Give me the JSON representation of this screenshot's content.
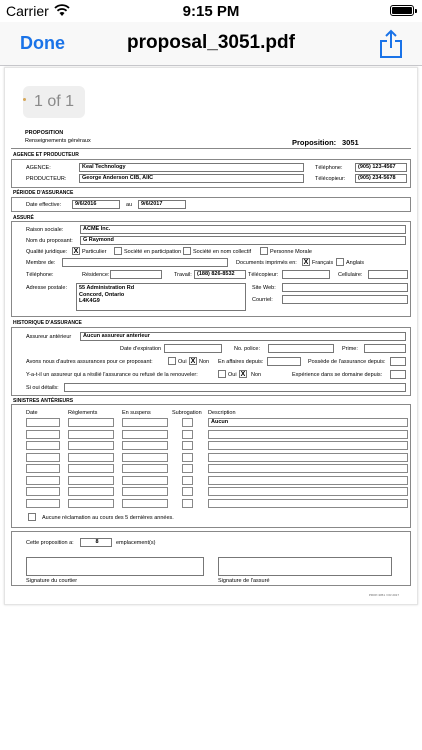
{
  "status": {
    "carrier": "Carrier",
    "time": "9:15 PM"
  },
  "nav": {
    "done_label": "Done",
    "title": "proposal_3051.pdf"
  },
  "viewer": {
    "page_counter": "1 of 1"
  },
  "form": {
    "header": {
      "proposition": "PROPOSITION",
      "subtitle": "Renseignements généraux",
      "prop_label": "Proposition:",
      "prop_number": "3051"
    },
    "agence": {
      "title": "AGENCE ET PRODUCTEUR",
      "agence_label": "AGENCE:",
      "agence_value": "Keal Technology",
      "producteur_label": "PRODUCTEUR:",
      "producteur_value": "George Anderson CIB, AIIC",
      "tel_label": "Téléphone:",
      "tel_value": "(905) 123-4567",
      "fax_label": "Télécopieur:",
      "fax_value": "(905) 234-5678"
    },
    "periode": {
      "title": "PÉRIODE D'ASSURANCE",
      "effective_label": "Date effective:",
      "effective_value": "9/6/2016",
      "au_label": "au",
      "au_value": "9/6/2017"
    },
    "assure": {
      "title": "ASSURÉ",
      "raison_label": "Raison sociale:",
      "raison_value": "ACME Inc.",
      "nom_label": "Nom du proposant:",
      "nom_value": "G Raymond",
      "qualite_label": "Qualité juridique:",
      "q_particulier": "Particulier",
      "q_particulier_mark": "X",
      "q_participation": "Société en participation",
      "q_collectif": "Société en nom collectif",
      "q_morale": "Personne Morale",
      "membre_label": "Membre de:",
      "documents_label": "Documents imprimés en:",
      "francais": "Français",
      "francais_mark": "X",
      "anglais": "Anglais",
      "telephone_label": "Téléphone:",
      "residence_label": "Résidence:",
      "travail_label": "Travail:",
      "travail_value": "(188) 826-8532",
      "telecopieur_label": "Télécopieur:",
      "cellulaire_label": "Cellulaire:",
      "adresse_label": "Adresse postale:",
      "adresse_line1": "55 Administration Rd",
      "adresse_line2": "Concord, Ontario",
      "adresse_line3": "L4K4G9",
      "siteweb_label": "Site Web:",
      "courriel_label": "Courriel:"
    },
    "historique": {
      "title": "HISTORIQUE D'ASSURANCE",
      "assureur_label": "Assureur antérieur",
      "assureur_value": "Aucun assureur anterieur",
      "expiration_label": "Date d'expiration",
      "police_label": "No. police:",
      "prime_label": "Prime:",
      "autres_label": "Avons nous d'autres  assurances pour ce proposant:",
      "oui": "Oui",
      "non": "Non",
      "non_mark": "X",
      "affaires_label": "En affaires depuis:",
      "possede_label": "Possède de l'assurance depuis:",
      "resilie_label": "Y-a-t-il un assureur qui a résilié l'assurance ou refusé de la renouveler:",
      "resilie_non_mark": "X",
      "experience_label": "Expérience dans se domaine depuis:",
      "details_label": "Si oui détails:"
    },
    "sinistres": {
      "title": "SINISTRES ANTÉRIEURS",
      "columns": [
        "Date",
        "Règlements",
        "En suspens",
        "Subrogation",
        "Description"
      ],
      "first_description": "Aucun",
      "aucune_label": "Aucune réclamation au cours des 5 dernières années."
    },
    "signature": {
      "cette_label": "Cette proposition a:",
      "cette_value": "8",
      "emplacements_label": "emplacement(s)",
      "courtier_label": "Signature du courtier",
      "assure_label": "Signature de l'assuré"
    },
    "footer_code": "PROP-3051 / FR 2017"
  }
}
